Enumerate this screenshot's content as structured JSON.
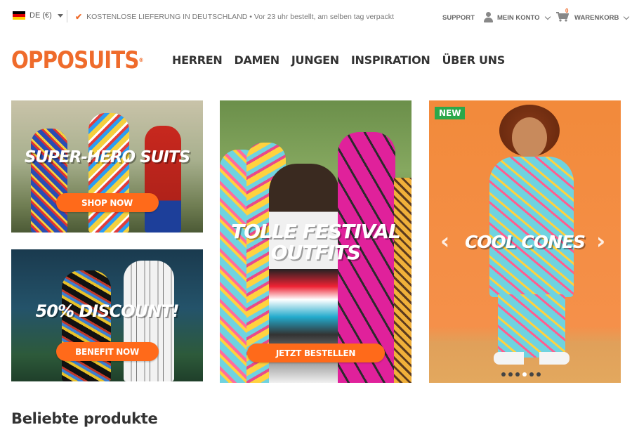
{
  "topbar": {
    "locale_label": "DE (€)",
    "promo_text": "KOSTENLOSE LIEFERUNG IN DEUTSCHLAND • Vor 23 uhr bestellt, am selben tag verpackt",
    "support_label": "SUPPORT",
    "account_label": "MEIN KONTO",
    "cart_label": "WARENKORB",
    "cart_count": "0"
  },
  "header": {
    "logo_text": "OPPOSUITS",
    "logo_mark": "®",
    "nav": [
      "HERREN",
      "DAMEN",
      "JUNGEN",
      "INSPIRATION",
      "ÜBER UNS"
    ]
  },
  "banners": {
    "superhero": {
      "headline": "SUPER-HERO SUITS",
      "cta": "SHOP NOW"
    },
    "discount": {
      "headline": "50% DISCOUNT!",
      "cta": "BENEFIT NOW"
    },
    "festival": {
      "headline_line1": "TOLLE FESTIVAL",
      "headline_line2": "OUTFITS",
      "cta": "JETZT BESTELLEN"
    },
    "coolcones": {
      "badge": "NEW",
      "headline": "COOL CONES",
      "prev": "‹",
      "next": "›",
      "active_dot": 4
    }
  },
  "main": {
    "section_title": "Beliebte produkte"
  },
  "colors": {
    "brand_orange": "#ef6b2b",
    "cta_orange": "#ff6a1a",
    "new_green": "#2ba84a"
  }
}
